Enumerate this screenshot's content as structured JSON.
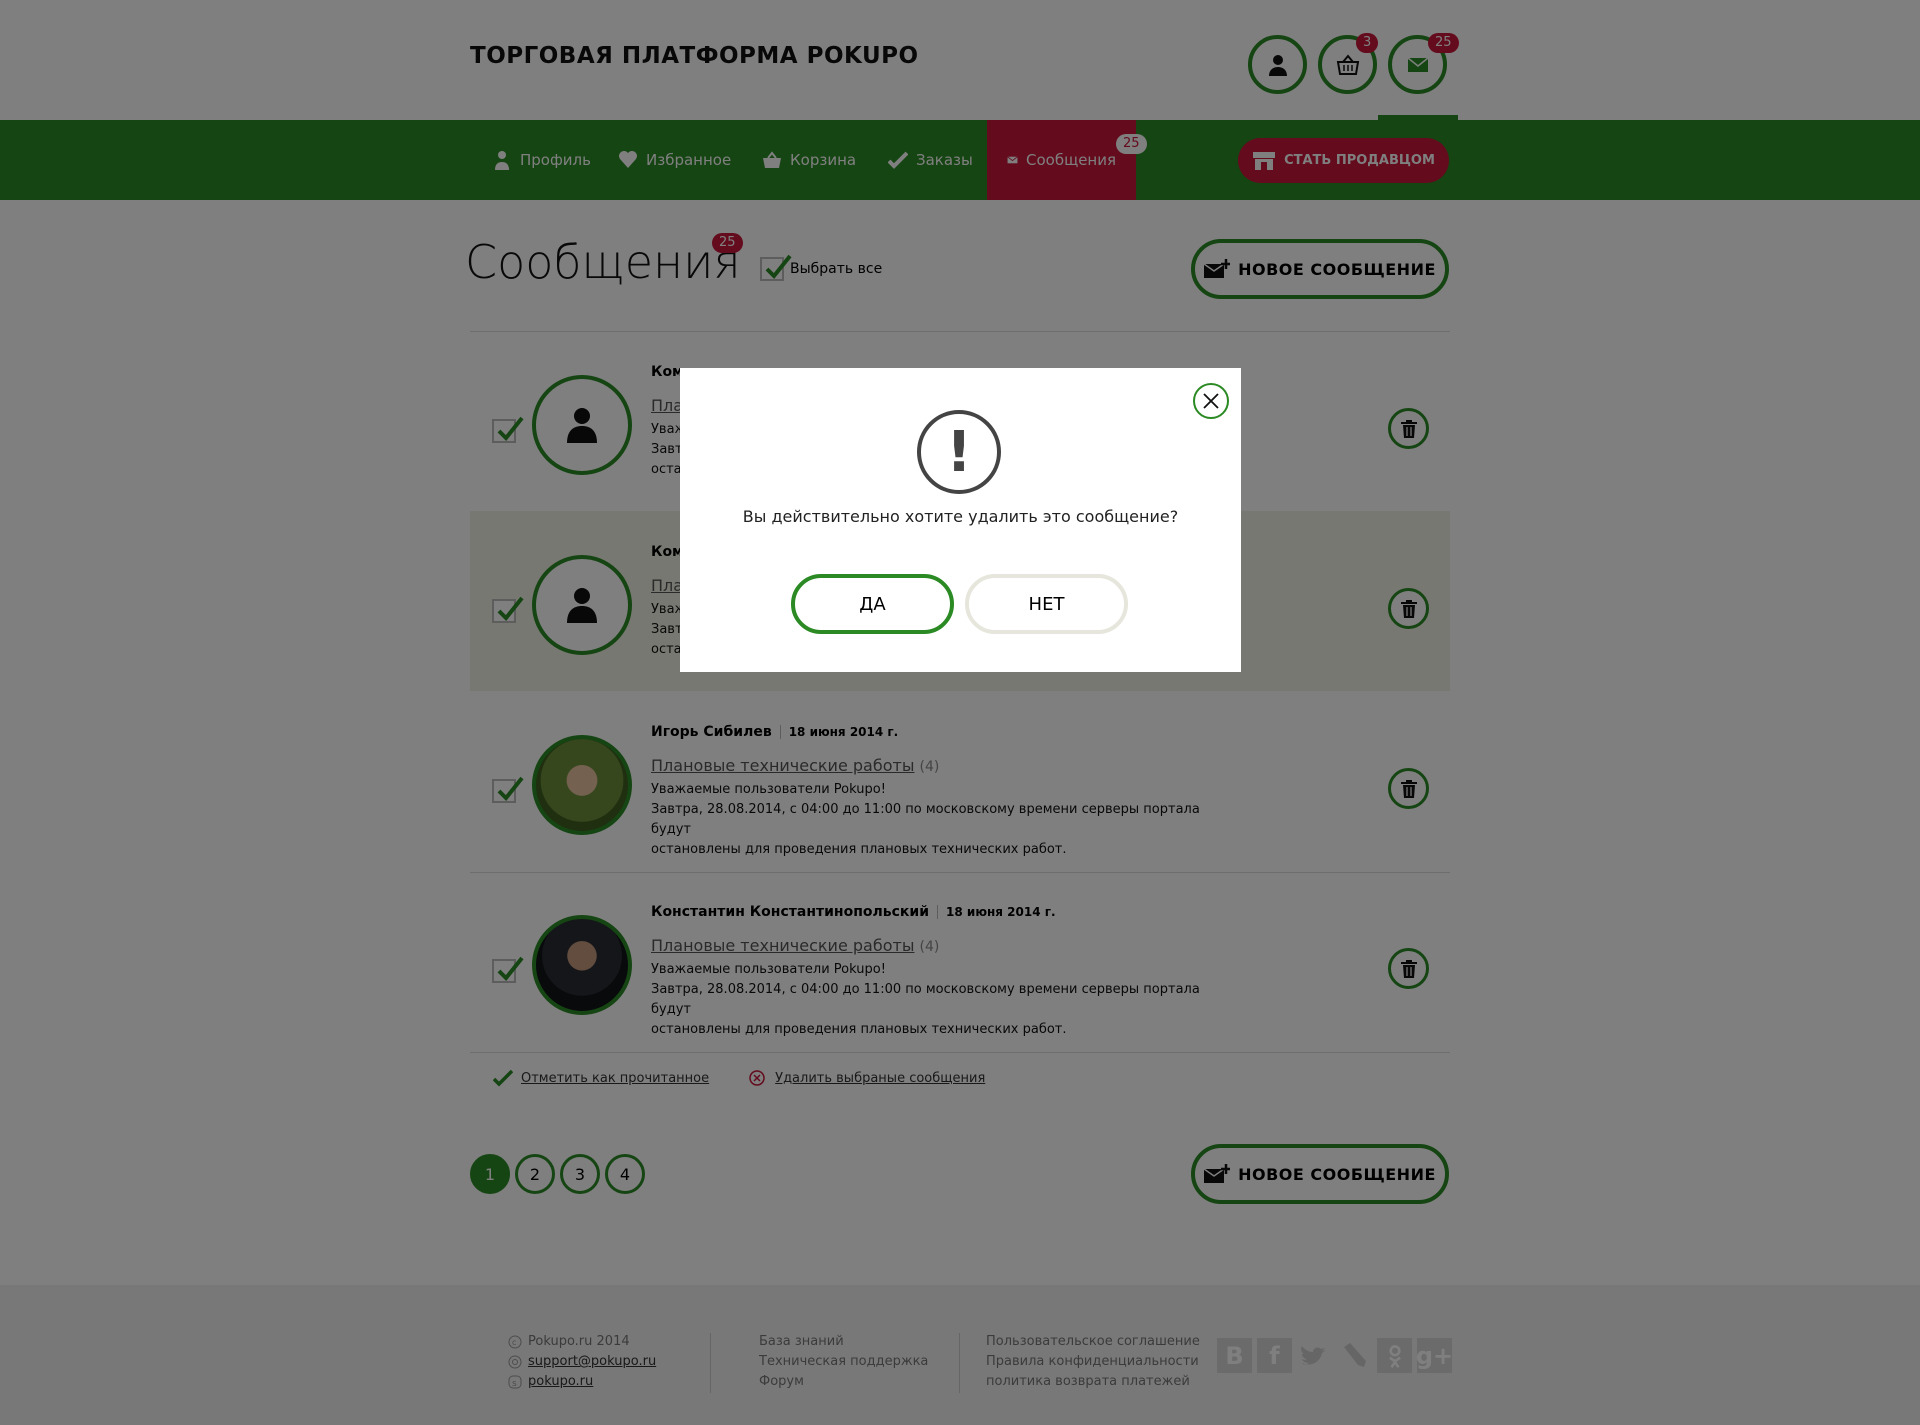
{
  "header": {
    "site_title": "ТОРГОВАЯ ПЛАТФОРМА POKUPO",
    "cart_badge": "3",
    "mail_badge": "25"
  },
  "nav": {
    "items": [
      {
        "label": "Профиль",
        "icon": "user-icon"
      },
      {
        "label": "Избранное",
        "icon": "heart-icon"
      },
      {
        "label": "Корзина",
        "icon": "basket-icon"
      },
      {
        "label": "Заказы",
        "icon": "check-icon"
      },
      {
        "label": "Сообщения",
        "icon": "envelope-icon",
        "active": true,
        "badge": "25"
      }
    ],
    "seller_button": "СТАТЬ ПРОДАВЦОМ"
  },
  "main": {
    "title": "Сообщения",
    "title_badge": "25",
    "select_all": "Выбрать все",
    "new_message": "НОВОЕ СООБЩЕНИЕ"
  },
  "messages": [
    {
      "sender": "Ком",
      "date": "",
      "subject": "Пла",
      "count": "",
      "lines": [
        "Уваж",
        "Завт",
        "оста"
      ]
    },
    {
      "sender": "Ком",
      "date": "",
      "subject": "Пла",
      "count": "",
      "lines": [
        "Уваж",
        "Завт",
        "оста"
      ]
    },
    {
      "sender": "Игорь Сибилев",
      "date": "18 июня 2014 г.",
      "subject": "Плановые технические работы",
      "count": "(4)",
      "lines": [
        "Уважаемые пользователи Pokupo!",
        "Завтра, 28.08.2014, с 04:00 до 11:00 по московскому времени серверы портала будут",
        "остановлены для проведения плановых технических работ."
      ]
    },
    {
      "sender": "Константин Константинопольский",
      "date": "18 июня 2014 г.",
      "subject": "Плановые технические работы",
      "count": "(4)",
      "lines": [
        "Уважаемые пользователи Pokupo!",
        "Завтра, 28.08.2014, с 04:00 до 11:00 по московскому времени серверы портала будут",
        "остановлены для проведения плановых технических работ."
      ]
    }
  ],
  "actions": {
    "mark_read": "Отметить как прочитанное",
    "delete_selected": "Удалить выбраные сообщения"
  },
  "pagination": [
    "1",
    "2",
    "3",
    "4"
  ],
  "footer": {
    "copyright": "Pokupo.ru 2014",
    "email": "support@pokupo.ru",
    "skype": "pokupo.ru",
    "col2": [
      "База знаний",
      "Техническая поддержка",
      "Форум"
    ],
    "col3": [
      "Пользовательское соглашение",
      "Правила конфиденциальности",
      "политика возврата платежей"
    ],
    "socials": [
      "В",
      "f",
      "",
      "",
      "",
      "g+"
    ]
  },
  "modal": {
    "text": "Вы действительно хотите удалить это сообщение?",
    "yes": "ДА",
    "no": "НЕТ"
  },
  "colors": {
    "accent_green": "#2b8a24",
    "accent_red": "#c8173a"
  }
}
